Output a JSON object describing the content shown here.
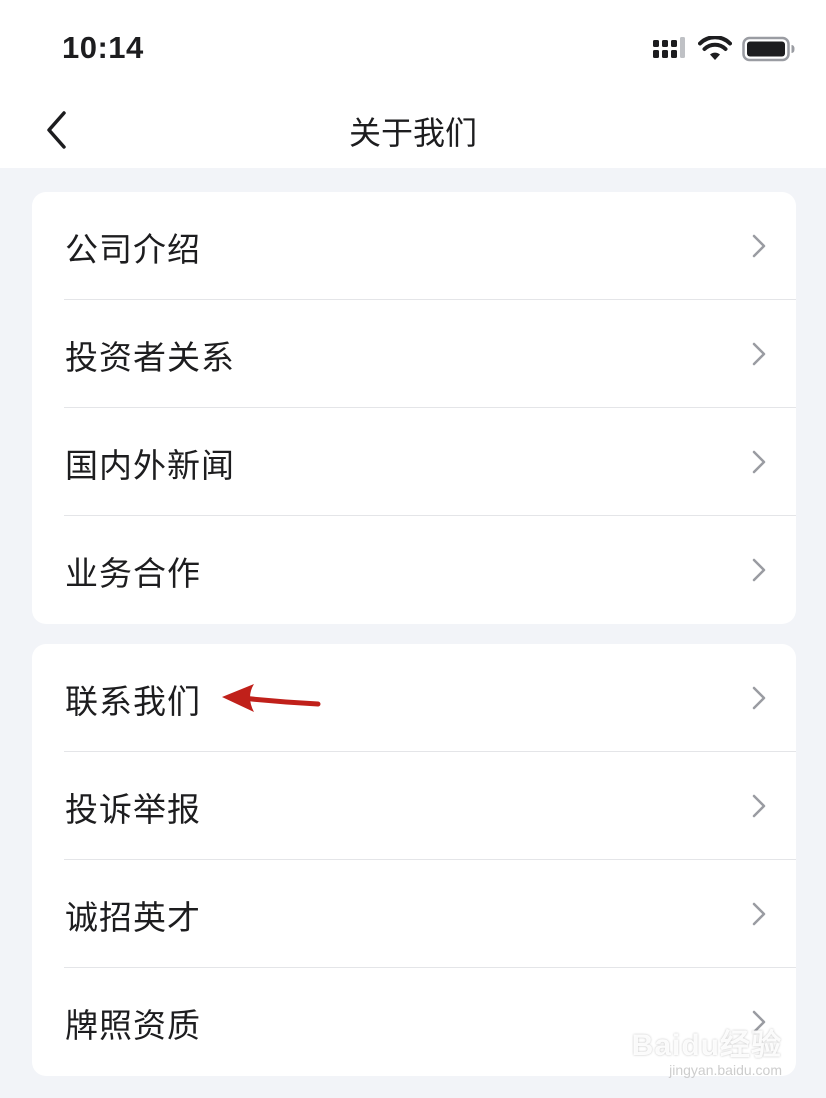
{
  "status_bar": {
    "time": "10:14"
  },
  "nav": {
    "title": "关于我们"
  },
  "groups": [
    {
      "items": [
        {
          "label": "公司介绍"
        },
        {
          "label": "投资者关系"
        },
        {
          "label": "国内外新闻"
        },
        {
          "label": "业务合作"
        }
      ]
    },
    {
      "items": [
        {
          "label": "联系我们"
        },
        {
          "label": "投诉举报"
        },
        {
          "label": "诚招英才"
        },
        {
          "label": "牌照资质"
        }
      ]
    }
  ],
  "watermark": {
    "brand": "Baidu经验",
    "url": "jingyan.baidu.com"
  },
  "colors": {
    "background": "#f2f4f8",
    "card": "#ffffff",
    "chevron": "#9a9ca2",
    "annotation_arrow": "#c0201a"
  }
}
